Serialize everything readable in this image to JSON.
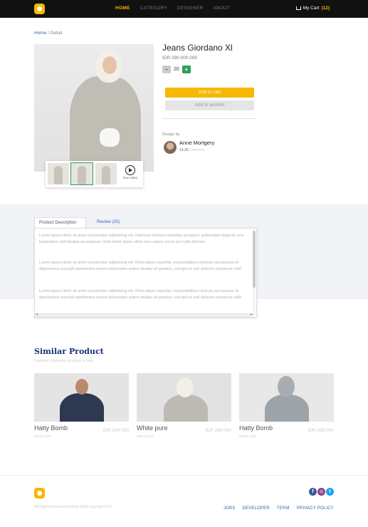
{
  "nav": {
    "menu": [
      "HOME",
      "CATEGORY",
      "DESIGNER",
      "ABOUT"
    ],
    "cart_label": "My Cart",
    "cart_count": "(12)"
  },
  "breadcrumb": {
    "home": "Home",
    "sep": " / ",
    "current": "Detail"
  },
  "product": {
    "title": "Jeans Giordano Xl",
    "price": "IDR 290.000.000",
    "quantity": "20",
    "minus_symbol": "−",
    "plus_symbol": "+",
    "add_to_cart": "Add to cart",
    "add_to_wishlist": "Add to wishlist",
    "play_label": "PLAY VIDEO"
  },
  "designer": {
    "label": "Design by",
    "name": "Anne Mortgery",
    "followers_count": "14.2K",
    "followers_label": "Followers"
  },
  "tabs": [
    "Product Description",
    "Review (20)"
  ],
  "description": [
    "Lorem ipsum dolor sit amet consectetur adipisicing elit. Delectus minima molestiae excepturi, quibusdam eligendi, iure laudantium velit beatae accusamus, modi animi atque ullam vero saepe rerum qui nulla dolorem",
    "Lorem ipsum dolor sit amet consectetur adipisicing elit. Dicta atque expedita, necessitatibus nostrum accusamus et dignissimos suscipit repellendus earum laboriosam autem beatae sit pariatur, corrupti ex sed dolorum possimus velit!",
    "Lorem ipsum dolor sit amet consectetur adipisicing elit. Dicta atque expedita, necessitatibus nostrum accusamus et dignissimos suscipit repellendus earum laboriosam autem beatae sit pariatur, corrupti ex sed dolorum possimus velit!"
  ],
  "similar": {
    "title": "Similar Product",
    "subtitle": "Fashion inspiration product is real",
    "items": [
      {
        "name": "Hatty Bomb",
        "price": "IDR 299.000",
        "date": "March 2016"
      },
      {
        "name": "White pure",
        "price": "IDR 299.000",
        "date": "March 2016"
      },
      {
        "name": "Hatty Bomb",
        "price": "IDR 299.000",
        "date": "March 2016"
      }
    ]
  },
  "footer": {
    "copyright": "All Rights Reserved by Bella Bella copyright 2021",
    "links": [
      "JOBS",
      "DEVELOPER",
      "TERM",
      "PRIVACY POLICY"
    ],
    "socials": [
      "f",
      "◎",
      "t"
    ]
  },
  "colors": {
    "accent": "#f6b800",
    "nav_bg": "#111111",
    "link": "#3a63b8",
    "green": "#2aa050",
    "heading": "#1b2d7a"
  }
}
